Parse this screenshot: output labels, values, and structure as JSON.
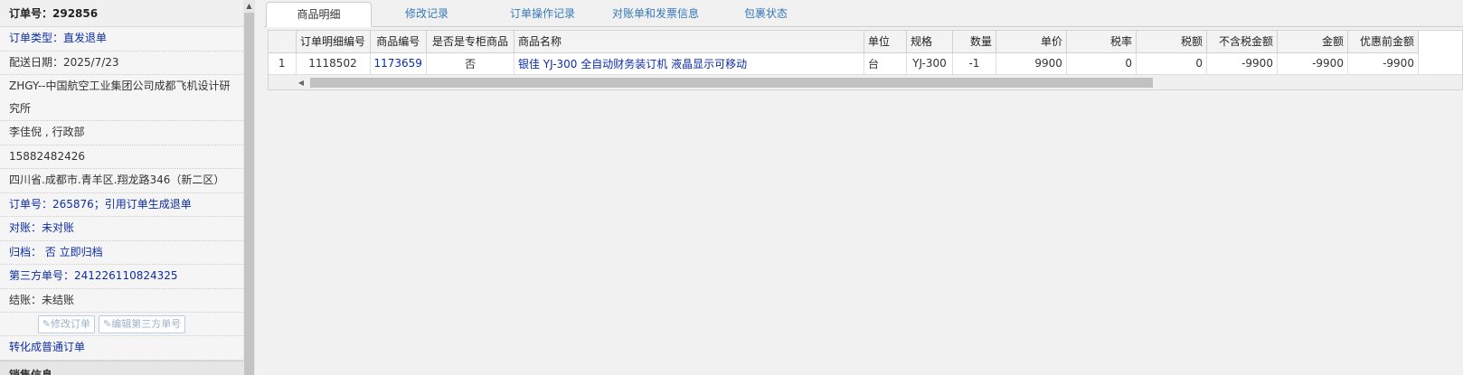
{
  "left": {
    "order_header": "订单号：292856",
    "rows": [
      {
        "text": "订单类型：直发退单",
        "blue": true
      },
      {
        "text": "配送日期：2025/7/23",
        "blue": false
      },
      {
        "text": "ZHGY--中国航空工业集团公司成都飞机设计研究所",
        "blue": false,
        "wrap": true
      },
      {
        "text": "李佳倪 , 行政部",
        "blue": false
      },
      {
        "text": "15882482426",
        "blue": false
      },
      {
        "text": "四川省.成都市.青羊区.翔龙路346（新二区）",
        "blue": false
      },
      {
        "text": "订单号：265876；引用订单生成退单",
        "blue": true
      },
      {
        "text": "对账：未对账",
        "blue": true
      },
      {
        "text": "归档： 否 立即归档",
        "blue": true
      },
      {
        "text": "第三方单号：241226110824325",
        "blue": true
      },
      {
        "text": "结账：未结账",
        "blue": false
      }
    ],
    "edit_order_label": "修改订单",
    "edit_third_party_label": "编辑第三方单号",
    "convert_label": "转化成普通订单",
    "sales_header": "销售信息"
  },
  "tabs": [
    "商品明细",
    "修改记录",
    "订单操作记录",
    "对账单和发票信息",
    "包裹状态"
  ],
  "table": {
    "columns": [
      "",
      "订单明细编号",
      "商品编号",
      "是否是专柜商品",
      "商品名称",
      "单位",
      "规格",
      "数量",
      "单价",
      "税率",
      "税额",
      "不含税金额",
      "金额",
      "优惠前金额"
    ],
    "rows": [
      [
        "1",
        "1118502",
        "1173659",
        "否",
        "银佳 YJ-300 全自动财务装订机 液晶显示可移动",
        "台",
        "YJ-300",
        "-1",
        "9900",
        "0",
        "0",
        "-9900",
        "-9900",
        "-9900"
      ]
    ]
  }
}
